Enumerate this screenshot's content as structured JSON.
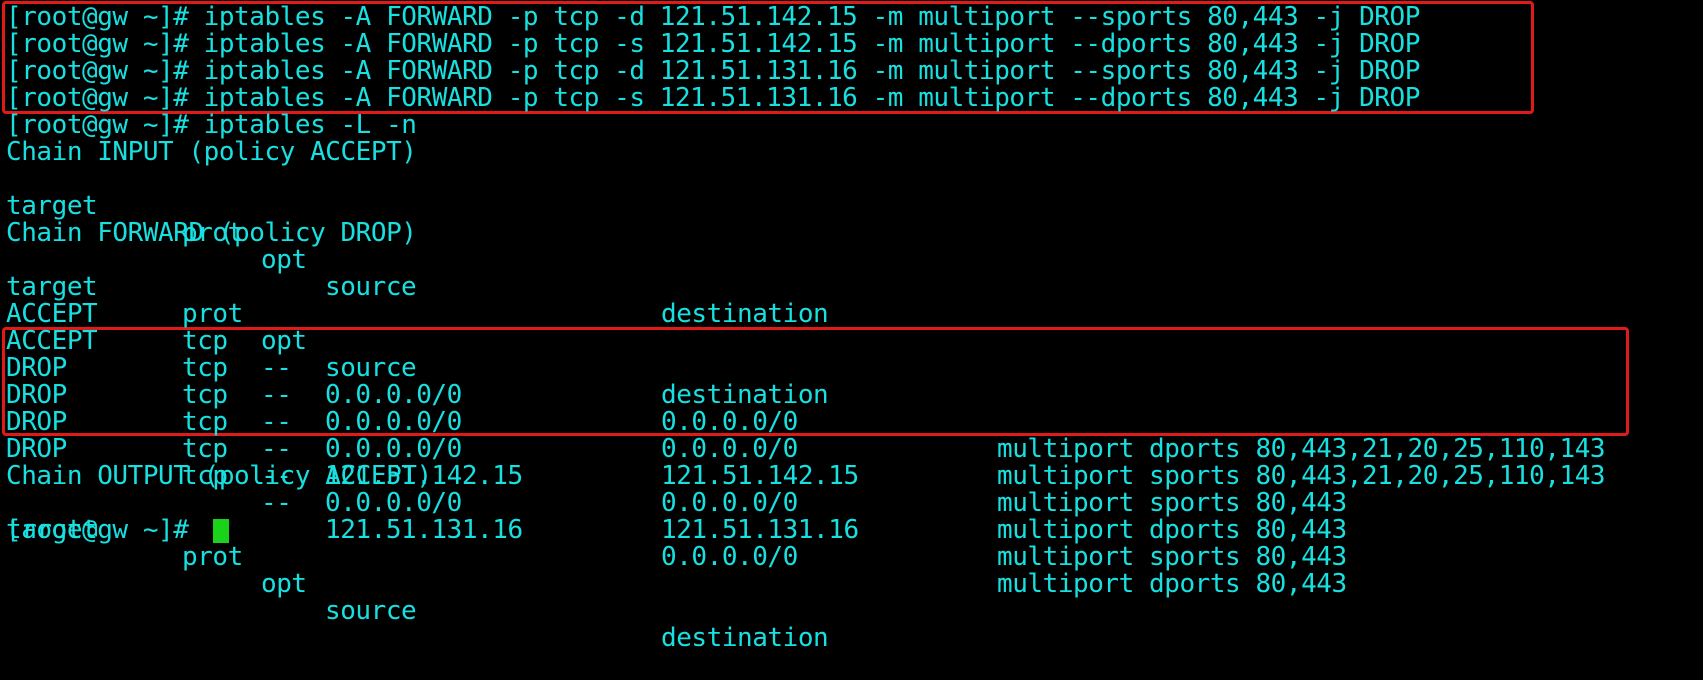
{
  "colors": {
    "background": "#000000",
    "text": "#18e0e0",
    "cursor": "#1bd21b",
    "highlight": "#e01a1a"
  },
  "commands": [
    "[root@gw ~]# iptables -A FORWARD -p tcp -d 121.51.142.15 -m multiport --sports 80,443 -j DROP",
    "[root@gw ~]# iptables -A FORWARD -p tcp -s 121.51.142.15 -m multiport --dports 80,443 -j DROP",
    "[root@gw ~]# iptables -A FORWARD -p tcp -d 121.51.131.16 -m multiport --sports 80,443 -j DROP",
    "[root@gw ~]# iptables -A FORWARD -p tcp -s 121.51.131.16 -m multiport --dports 80,443 -j DROP",
    "[root@gw ~]# iptables -L -n"
  ],
  "chain_input": {
    "title": "Chain INPUT (policy ACCEPT)",
    "headers": {
      "target": "target",
      "prot": "prot",
      "opt": "opt",
      "source": "source",
      "destination": "destination"
    }
  },
  "chain_forward": {
    "title": "Chain FORWARD (policy DROP)",
    "headers": {
      "target": "target",
      "prot": "prot",
      "opt": "opt",
      "source": "source",
      "destination": "destination"
    },
    "rows": [
      {
        "target": "ACCEPT",
        "prot": "tcp",
        "opt": "--",
        "source": "0.0.0.0/0",
        "destination": "0.0.0.0/0",
        "extra": "multiport dports 80,443,21,20,25,110,143"
      },
      {
        "target": "ACCEPT",
        "prot": "tcp",
        "opt": "--",
        "source": "0.0.0.0/0",
        "destination": "0.0.0.0/0",
        "extra": "multiport sports 80,443,21,20,25,110,143"
      },
      {
        "target": "DROP",
        "prot": "tcp",
        "opt": "--",
        "source": "0.0.0.0/0",
        "destination": "121.51.142.15",
        "extra": "multiport sports 80,443"
      },
      {
        "target": "DROP",
        "prot": "tcp",
        "opt": "--",
        "source": "121.51.142.15",
        "destination": "0.0.0.0/0",
        "extra": "multiport dports 80,443"
      },
      {
        "target": "DROP",
        "prot": "tcp",
        "opt": "--",
        "source": "0.0.0.0/0",
        "destination": "121.51.131.16",
        "extra": "multiport sports 80,443"
      },
      {
        "target": "DROP",
        "prot": "tcp",
        "opt": "--",
        "source": "121.51.131.16",
        "destination": "0.0.0.0/0",
        "extra": "multiport dports 80,443"
      }
    ]
  },
  "chain_output": {
    "title": "Chain OUTPUT (policy ACCEPT)",
    "headers": {
      "target": "target",
      "prot": "prot",
      "opt": "opt",
      "source": "source",
      "destination": "destination"
    }
  },
  "prompt": "[root@gw ~]#"
}
